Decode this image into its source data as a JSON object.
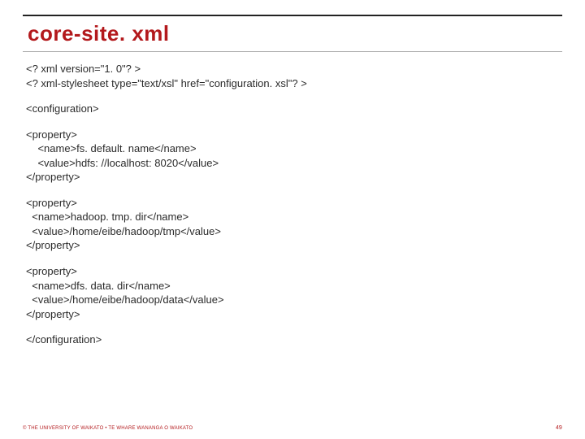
{
  "title": "core-site. xml",
  "xml_header": "<? xml version=\"1. 0\"? >\n<? xml-stylesheet type=\"text/xsl\" href=\"configuration. xsl\"? >",
  "config_open": "<configuration>",
  "property1": "<property>\n    <name>fs. default. name</name>\n    <value>hdfs: //localhost: 8020</value>\n</property>",
  "property2": "<property>\n  <name>hadoop. tmp. dir</name>\n  <value>/home/eibe/hadoop/tmp</value>\n</property>",
  "property3": "<property>\n  <name>dfs. data. dir</name>\n  <value>/home/eibe/hadoop/data</value>\n</property>",
  "config_close": "</configuration>",
  "footer": {
    "copyright": "© THE UNIVERSITY OF WAIKATO  •  TE WHARE WANANGA O WAIKATO",
    "page": "49"
  }
}
